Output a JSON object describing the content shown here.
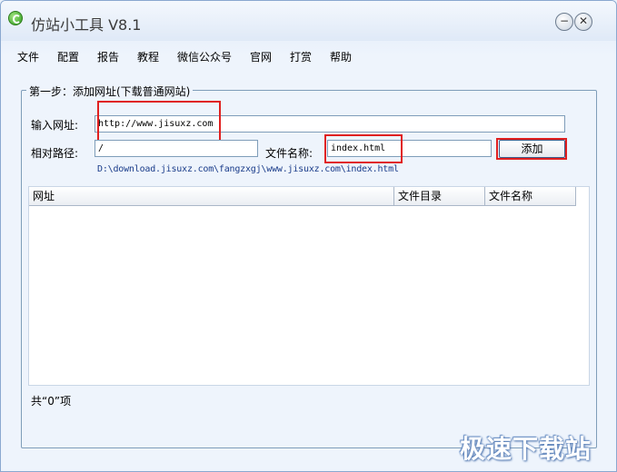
{
  "window": {
    "title": "仿站小工具 V8.1",
    "minimize_glyph": "−",
    "close_glyph": "✕"
  },
  "menu": {
    "items": [
      {
        "label": "文件"
      },
      {
        "label": "配置"
      },
      {
        "label": "报告"
      },
      {
        "label": "教程"
      },
      {
        "label": "微信公众号"
      },
      {
        "label": "官网"
      },
      {
        "label": "打赏"
      },
      {
        "label": "帮助"
      }
    ]
  },
  "step": {
    "group_title": "第一步：添加网址(下载普通网站)",
    "url_label": "输入网址:",
    "url_value": "http://www.jisuxz.com",
    "relpath_label": "相对路径:",
    "relpath_value": "/",
    "filename_label": "文件名称:",
    "filename_value": "index.html",
    "add_label": "添加",
    "save_path": "D:\\download.jisuxz.com\\fangzxgj\\www.jisuxz.com\\index.html"
  },
  "list": {
    "columns": [
      "网址",
      "文件目录",
      "文件名称"
    ],
    "rows": []
  },
  "status": {
    "count_text": "共“0”项"
  },
  "watermark": "极速下载站",
  "colors": {
    "highlight": "#e02020",
    "path_text": "#1a3c8a",
    "border": "#7f9db9"
  }
}
